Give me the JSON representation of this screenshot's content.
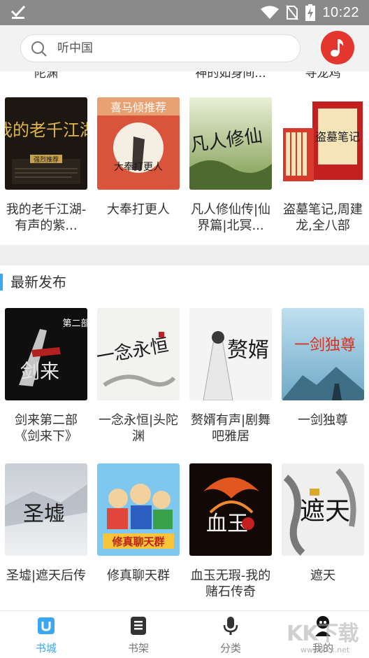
{
  "status_bar": {
    "time": "10:22"
  },
  "search": {
    "placeholder": "听中国"
  },
  "cut_off_titles": [
    "陀渊",
    "神的如身间...",
    "寻龙鸡"
  ],
  "hot_books": [
    {
      "title": "我的老千江湖-有声的紫...",
      "cover_text": "我的老千江湖",
      "badge": "强烈推荐"
    },
    {
      "title": "大奉打更人",
      "cover_text": "大奉打更人",
      "badge": "喜马倾推荐"
    },
    {
      "title": "凡人修仙传|仙界篇|北冥...",
      "cover_text": "凡人修仙"
    },
    {
      "title": "盗墓笔记,周建龙,全八部",
      "cover_text": "盗墓笔记"
    }
  ],
  "section": {
    "title": "最新发布"
  },
  "latest_books": [
    {
      "title": "剑来第二部《剑来下》",
      "cover_text": "剑来",
      "cover_sub": "第二部"
    },
    {
      "title": "一念永恒|头陀渊",
      "cover_text": "一念永恒"
    },
    {
      "title": "赘婿有声|剧舞吧雅居",
      "cover_text": "赘婿"
    },
    {
      "title": "一剑独尊",
      "cover_text": "一剑独尊"
    },
    {
      "title": "圣墟|遮天后传",
      "cover_text": "圣墟"
    },
    {
      "title": "修真聊天群",
      "cover_text": "修真聊天群"
    },
    {
      "title": "血玉无瑕-我的赌石传奇",
      "cover_text": "血玉"
    },
    {
      "title": "遮天",
      "cover_text": "遮天"
    }
  ],
  "tabs": [
    {
      "label": "书城",
      "icon": "bookstore-icon",
      "active": true
    },
    {
      "label": "书架",
      "icon": "bookshelf-icon"
    },
    {
      "label": "分类",
      "icon": "microphone-icon"
    },
    {
      "label": "我的",
      "icon": "profile-icon"
    }
  ],
  "watermark": {
    "text": "KK下载",
    "sub": "www.kkx.net"
  },
  "colors": {
    "accent": "#3aa7f0",
    "music_button": "#e3362c",
    "status_bar": "#8a8a8a"
  }
}
